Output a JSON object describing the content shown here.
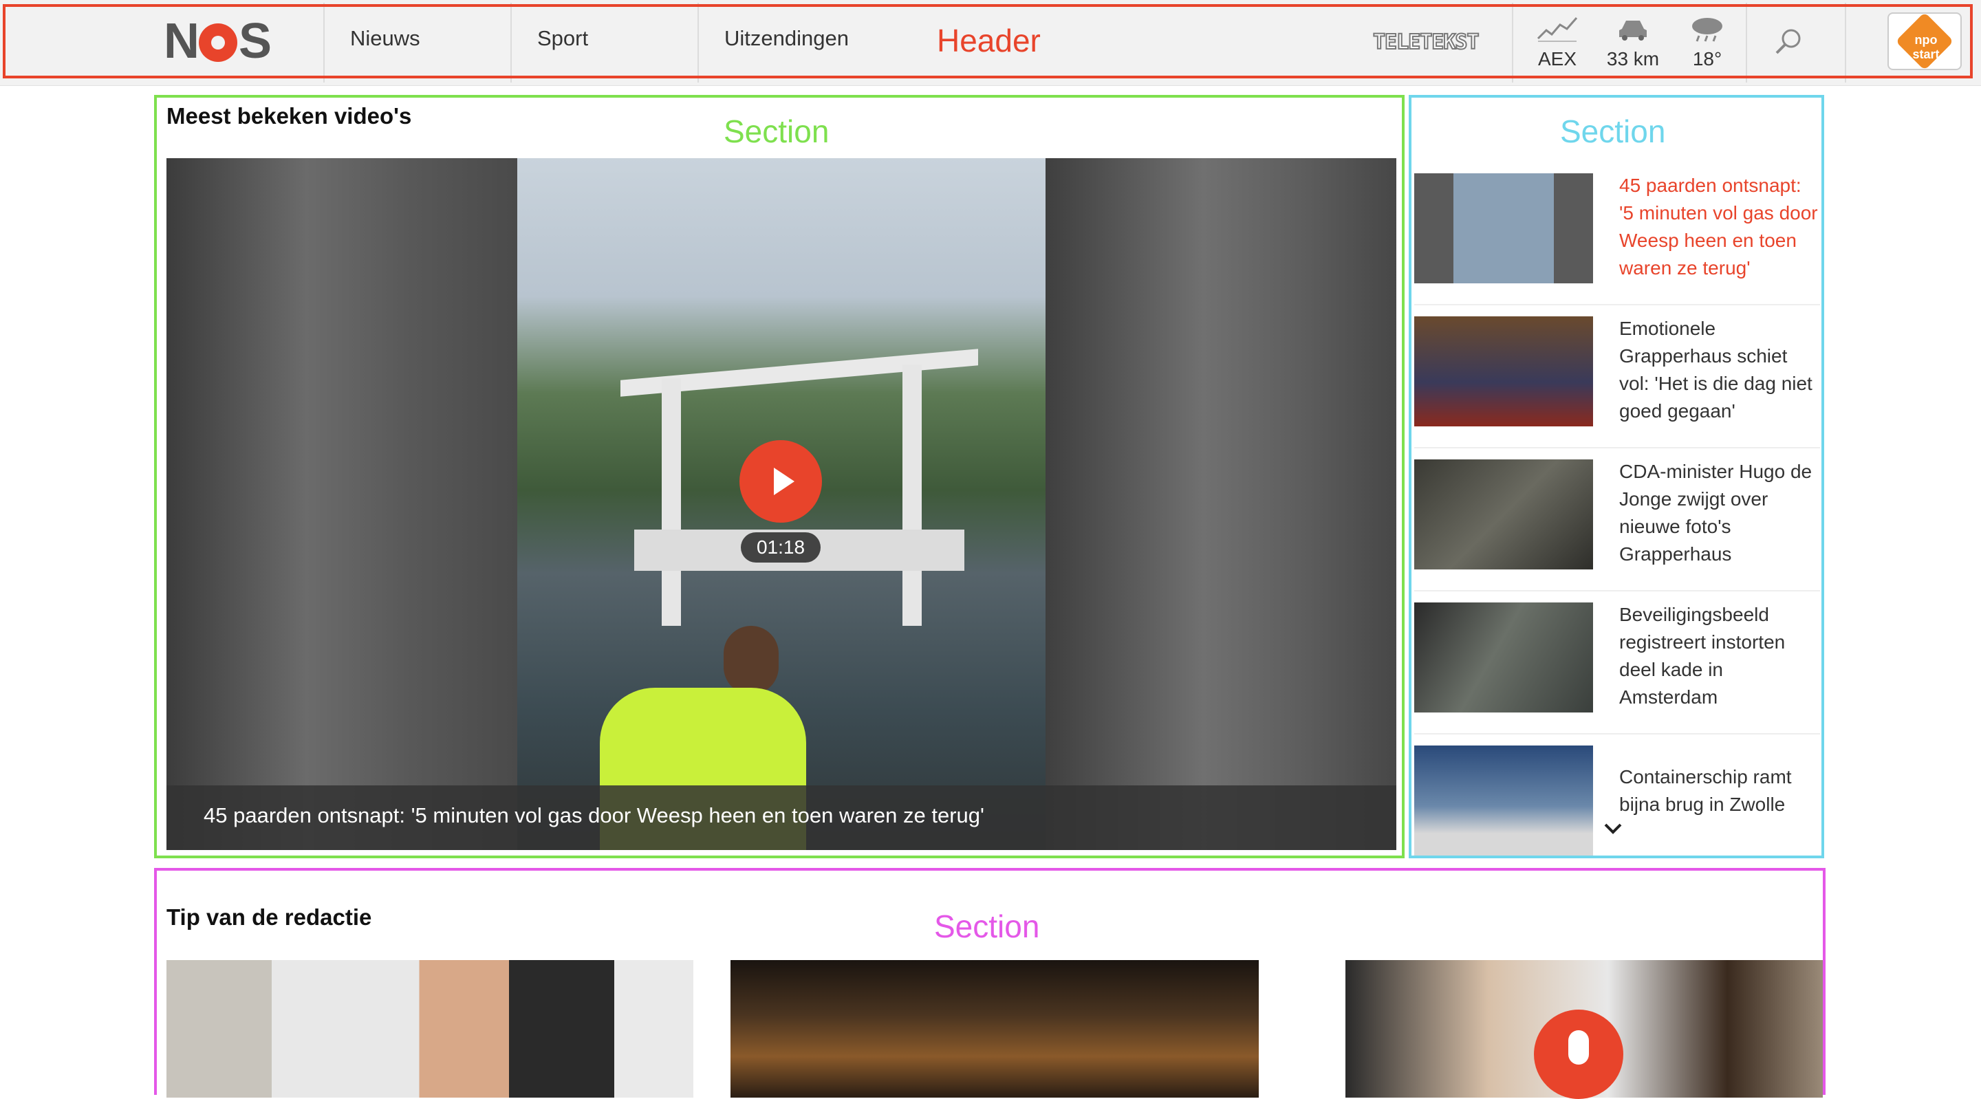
{
  "header": {
    "logo": "NOS",
    "nav": [
      "Nieuws",
      "Sport",
      "Uitzendingen"
    ],
    "label": "Header",
    "teletekst": "TELETEKST",
    "widgets": [
      {
        "label": "AEX",
        "icon": "stock-chart-icon"
      },
      {
        "label": "33 km",
        "icon": "car-icon"
      },
      {
        "label": "18°",
        "icon": "rain-cloud-icon"
      }
    ],
    "search_icon": "search-icon",
    "npo_start": "npo start"
  },
  "section_label": "Section",
  "most_viewed": {
    "title": "Meest bekeken video's",
    "featured": {
      "duration": "01:18",
      "caption": "45 paarden ontsnapt: '5 minuten vol gas door Weesp heen en toen waren ze terug'"
    },
    "items": [
      {
        "text": "45 paarden ontsnapt: '5 minuten vol gas door Weesp heen en toen waren ze terug'",
        "active": true
      },
      {
        "text": "Emotionele Grapperhaus schiet vol: 'Het is die dag niet goed gegaan'",
        "active": false
      },
      {
        "text": "CDA-minister Hugo de Jonge zwijgt over nieuwe foto's Grapperhaus",
        "active": false
      },
      {
        "text": "Beveiligingsbeeld registreert instorten deel kade in Amsterdam",
        "active": false
      },
      {
        "text": "Containerschip ramt bijna brug in Zwolle",
        "active": false
      }
    ]
  },
  "tip": {
    "title": "Tip van de redactie"
  },
  "colors": {
    "accent": "#e8442b",
    "header_outline": "#e8442b",
    "section1_outline": "#7ee04e",
    "section2_outline": "#6fd6ec",
    "section3_outline": "#e458e8"
  }
}
